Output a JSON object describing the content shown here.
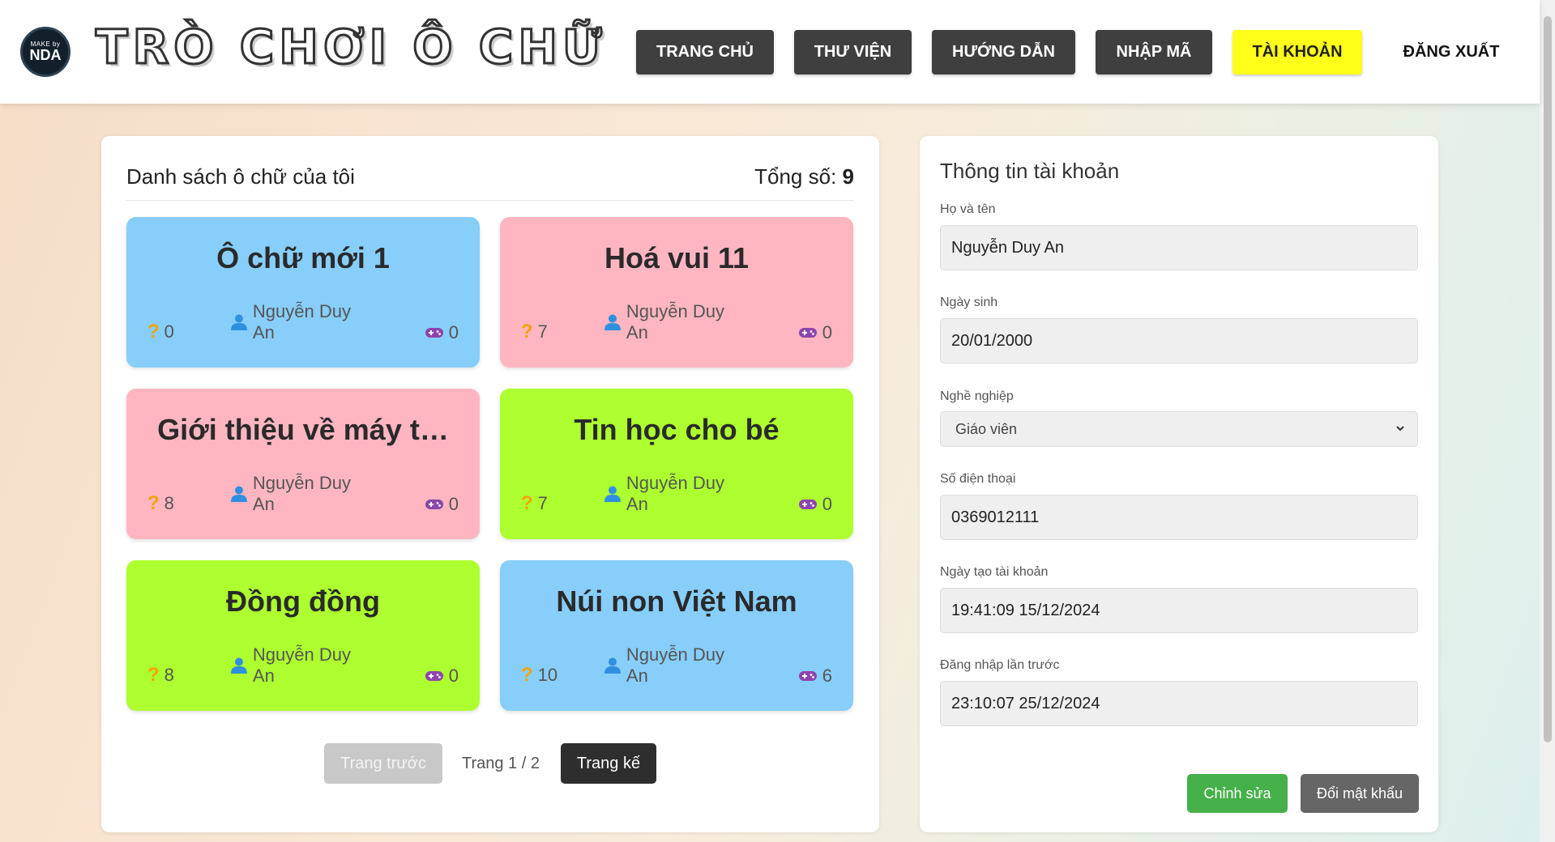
{
  "header": {
    "logo": {
      "small": "MAKE by",
      "big": "NDA"
    },
    "title": "TRÒ CHƠI Ô CHỮ",
    "nav": [
      {
        "label": "TRANG CHỦ",
        "active": false
      },
      {
        "label": "THƯ VIỆN",
        "active": false
      },
      {
        "label": "HƯỚNG DẪN",
        "active": false
      },
      {
        "label": "NHẬP MÃ",
        "active": false
      },
      {
        "label": "TÀI KHOẢN",
        "active": true
      },
      {
        "label": "ĐĂNG XUẤT",
        "active": false
      }
    ]
  },
  "list": {
    "title": "Danh sách ô chữ của tôi",
    "total_label": "Tổng số:",
    "total": "9",
    "cards": [
      {
        "title": "Ô chữ mới 1",
        "questions": "0",
        "author": "Nguyễn Duy An",
        "plays": "0",
        "color": "#87cefa"
      },
      {
        "title": "Hoá vui 11",
        "questions": "7",
        "author": "Nguyễn Duy An",
        "plays": "0",
        "color": "#ffb6c1"
      },
      {
        "title": "Giới thiệu về máy t…",
        "questions": "8",
        "author": "Nguyễn Duy An",
        "plays": "0",
        "color": "#ffb6c1"
      },
      {
        "title": "Tin học cho bé",
        "questions": "7",
        "author": "Nguyễn Duy An",
        "plays": "0",
        "color": "#adff2f"
      },
      {
        "title": "Đồng đồng",
        "questions": "8",
        "author": "Nguyễn Duy An",
        "plays": "0",
        "color": "#adff2f"
      },
      {
        "title": "Núi non Việt Nam",
        "questions": "10",
        "author": "Nguyễn Duy An",
        "plays": "6",
        "color": "#87cefa"
      }
    ],
    "pager": {
      "prev": "Trang trước",
      "info": "Trang 1 / 2",
      "next": "Trang kế"
    }
  },
  "account": {
    "title": "Thông tin tài khoản",
    "fields": [
      {
        "label": "Họ và tên",
        "value": "Nguyễn Duy An"
      },
      {
        "label": "Ngày sinh",
        "value": "20/01/2000"
      },
      {
        "label": "Nghề nghiệp",
        "value": "Giáo viên"
      },
      {
        "label": "Số điện thoại",
        "value": "0369012111"
      },
      {
        "label": "Ngày tạo tài khoản",
        "value": "19:41:09 15/12/2024"
      },
      {
        "label": "Đăng nhập lần trước",
        "value": "23:10:07 25/12/2024"
      }
    ],
    "edit_label": "Chỉnh sửa",
    "password_label": "Đổi mật khẩu"
  },
  "colors": {
    "nav_bg": "#3f3f3f",
    "nav_active": "#ffff1a",
    "question_icon": "#f5a300",
    "user_icon": "#2f8fe0",
    "game_icon": "#8e44ad",
    "edit_button": "#45b04a"
  }
}
